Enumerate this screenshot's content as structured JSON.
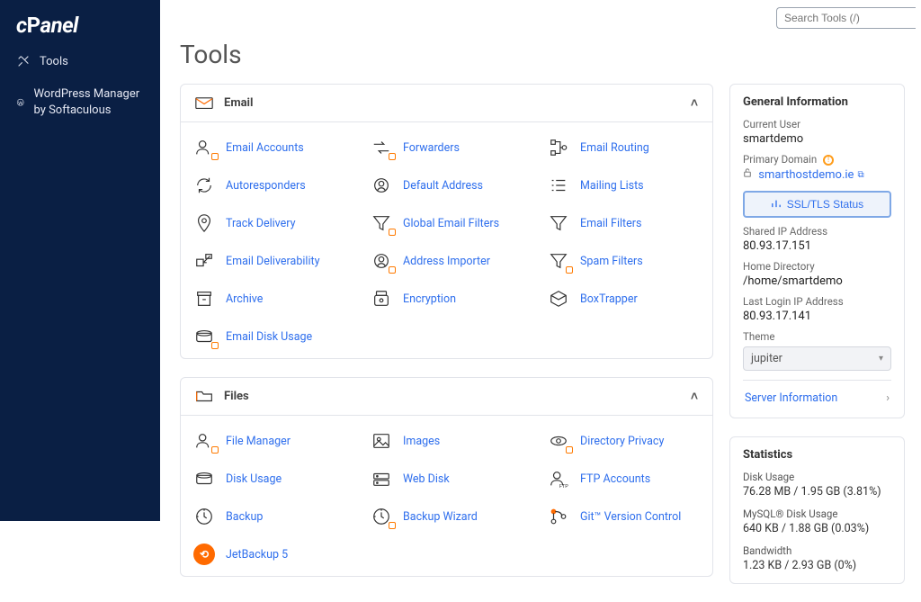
{
  "brand": "cPanel",
  "search_placeholder": "Search Tools (/)",
  "page_title": "Tools",
  "sidebar": {
    "items": [
      {
        "label": "Tools",
        "icon": "wrench"
      },
      {
        "label": "WordPress Manager by Softaculous",
        "icon": "wordpress"
      }
    ]
  },
  "panels": [
    {
      "title": "Email",
      "icon": "mail",
      "items": [
        {
          "label": "Email Accounts"
        },
        {
          "label": "Forwarders"
        },
        {
          "label": "Email Routing"
        },
        {
          "label": "Autoresponders"
        },
        {
          "label": "Default Address"
        },
        {
          "label": "Mailing Lists"
        },
        {
          "label": "Track Delivery"
        },
        {
          "label": "Global Email Filters"
        },
        {
          "label": "Email Filters"
        },
        {
          "label": "Email Deliverability"
        },
        {
          "label": "Address Importer"
        },
        {
          "label": "Spam Filters"
        },
        {
          "label": "Archive"
        },
        {
          "label": "Encryption"
        },
        {
          "label": "BoxTrapper"
        },
        {
          "label": "Email Disk Usage"
        }
      ]
    },
    {
      "title": "Files",
      "icon": "folder",
      "items": [
        {
          "label": "File Manager"
        },
        {
          "label": "Images"
        },
        {
          "label": "Directory Privacy"
        },
        {
          "label": "Disk Usage"
        },
        {
          "label": "Web Disk"
        },
        {
          "label": "FTP Accounts"
        },
        {
          "label": "Backup"
        },
        {
          "label": "Backup Wizard"
        },
        {
          "label": "Git™ Version Control"
        },
        {
          "label": "JetBackup 5",
          "special": "jetbackup"
        }
      ]
    }
  ],
  "general": {
    "title": "General Information",
    "current_user_label": "Current User",
    "current_user": "smartdemo",
    "primary_domain_label": "Primary Domain",
    "primary_domain": "smarthostdemo.ie",
    "ssl_button": "SSL/TLS Status",
    "shared_ip_label": "Shared IP Address",
    "shared_ip": "80.93.17.151",
    "home_dir_label": "Home Directory",
    "home_dir": "/home/smartdemo",
    "last_login_label": "Last Login IP Address",
    "last_login": "80.93.17.141",
    "theme_label": "Theme",
    "theme_value": "jupiter",
    "server_info": "Server Information"
  },
  "stats": {
    "title": "Statistics",
    "items": [
      {
        "label": "Disk Usage",
        "value": "76.28 MB / 1.95 GB   (3.81%)"
      },
      {
        "label": "MySQL® Disk Usage",
        "value": "640 KB / 1.88 GB   (0.03%)"
      },
      {
        "label": "Bandwidth",
        "value": "1.23 KB / 2.93 GB   (0%)"
      }
    ]
  }
}
